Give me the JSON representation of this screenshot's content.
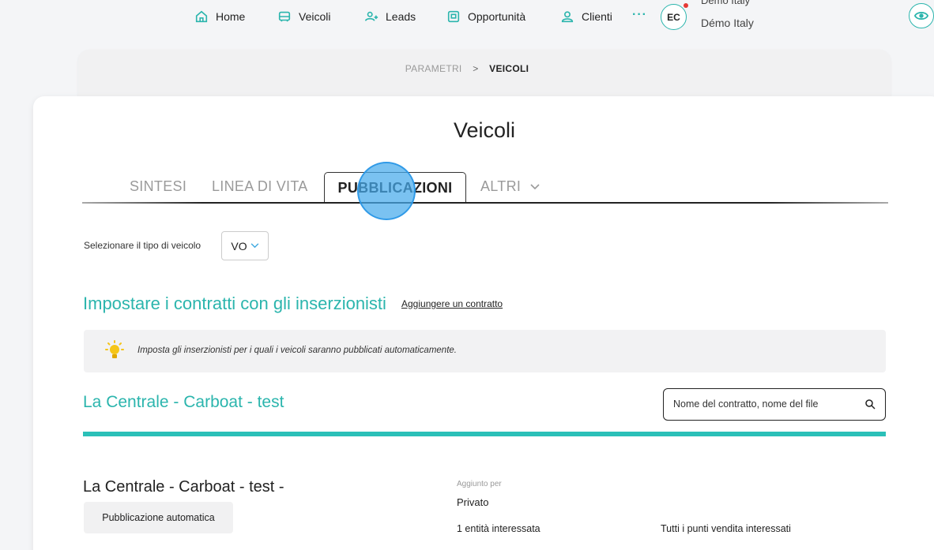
{
  "nav": {
    "items": [
      {
        "label": "Home",
        "icon": "home-icon"
      },
      {
        "label": "Veicoli",
        "icon": "car-icon"
      },
      {
        "label": "Leads",
        "icon": "leads-icon"
      },
      {
        "label": "Opportunità",
        "icon": "opportunity-icon"
      },
      {
        "label": "Clienti",
        "icon": "user-icon"
      }
    ],
    "more": "···",
    "avatar_initials": "EC",
    "user_top": "Démo Italy",
    "user_bottom": "Démo Italy"
  },
  "breadcrumb": {
    "parent": "PARAMETRI",
    "separator": ">",
    "current": "VEICOLI"
  },
  "page_title": "Veicoli",
  "tabs": {
    "items": [
      "SINTESI",
      "LINEA DI VITA",
      "PUBBLICAZIONI",
      "ALTRI"
    ],
    "active": "PUBBLICAZIONI"
  },
  "vehicle_type": {
    "label": "Selezionare il tipo di veicolo",
    "value": "VO"
  },
  "contracts": {
    "title": "Impostare i contratti con gli inserzionisti",
    "add_link": "Aggiungere un contratto",
    "info": "Imposta gli inserzionisti per i quali i veicoli saranno pubblicati automaticamente."
  },
  "contract_section": {
    "title": "La Centrale - Carboat - test",
    "search_placeholder": "Nome del contratto, nome del file"
  },
  "contract_item": {
    "title": "La Centrale - Carboat - test -",
    "badge": "Pubblicazione automatica",
    "added_label": "Aggiunto per",
    "added_value": "Privato",
    "entities": "1 entità interessata",
    "points": "Tutti i punti vendita interessati"
  },
  "colors": {
    "accent": "#2bb5ad",
    "touch": "#46aaeb"
  }
}
